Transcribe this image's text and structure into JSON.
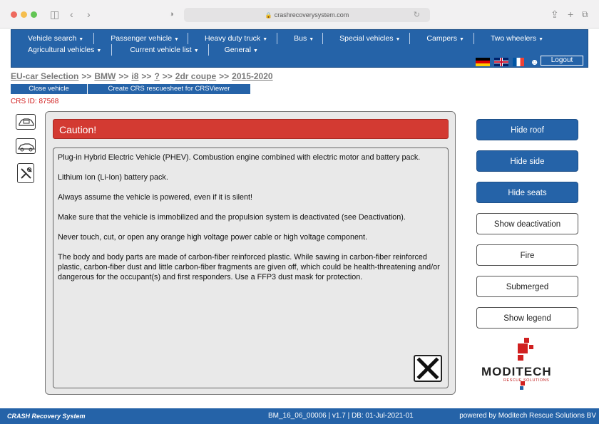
{
  "browser": {
    "url": "crashrecoverysystem.com"
  },
  "nav": {
    "row1": [
      {
        "label": "Vehicle search"
      },
      {
        "label": "Passenger vehicle"
      },
      {
        "label": "Heavy duty truck"
      },
      {
        "label": "Bus"
      },
      {
        "label": "Special vehicles"
      },
      {
        "label": "Campers"
      },
      {
        "label": "Two wheelers"
      }
    ],
    "row2": [
      {
        "label": "Agricultural vehicles"
      },
      {
        "label": "Current vehicle list"
      },
      {
        "label": "General"
      }
    ],
    "logout": "Logout"
  },
  "breadcrumb": {
    "root": "EU-car Selection",
    "make": "BMW",
    "model": "i8",
    "unknown": "?",
    "body": "2dr coupe",
    "years": "2015-2020"
  },
  "actions": {
    "close_vehicle": "Close vehicle",
    "create_sheet": "Create CRS rescuesheet for CRSViewer"
  },
  "crs_id": "CRS ID: 87568",
  "dialog": {
    "title": "Caution!",
    "paragraphs": [
      "Plug-in Hybrid Electric Vehicle (PHEV). Combustion engine combined with electric motor and battery pack.",
      "Lithium Ion (Li-Ion) battery pack.",
      "Always assume the vehicle is powered, even if it is silent!",
      "Make sure that the vehicle is immobilized and the propulsion system is deactivated (see Deactivation).",
      "Never touch, cut, or open any orange high voltage power cable or high voltage component.",
      "The body and body parts are made of carbon-fiber reinforced plastic. While sawing in carbon-fiber reinforced plastic, carbon-fiber dust and little carbon-fiber fragments are given off, which could be health-threatening and/or dangerous for the occupant(s) and first responders. Use a FFP3 dust mask for protection."
    ]
  },
  "right_buttons": {
    "hide_roof": "Hide roof",
    "hide_side": "Hide side",
    "hide_seats": "Hide seats",
    "show_deactivation": "Show deactivation",
    "fire": "Fire",
    "submerged": "Submerged",
    "show_legend": "Show legend"
  },
  "logo": {
    "word": "MODITECH",
    "tagline": "RESCUE SOLUTIONS"
  },
  "footer": {
    "brand": "CRASH Recovery System",
    "version": "BM_16_06_00006 | v1.7 | DB: 01-Jul-2021-01",
    "powered": "powered by Moditech Rescue Solutions BV"
  },
  "colors": {
    "primary_blue": "#2563a8",
    "caution_red": "#d33a32",
    "crs_id_red": "#d01b1b"
  }
}
